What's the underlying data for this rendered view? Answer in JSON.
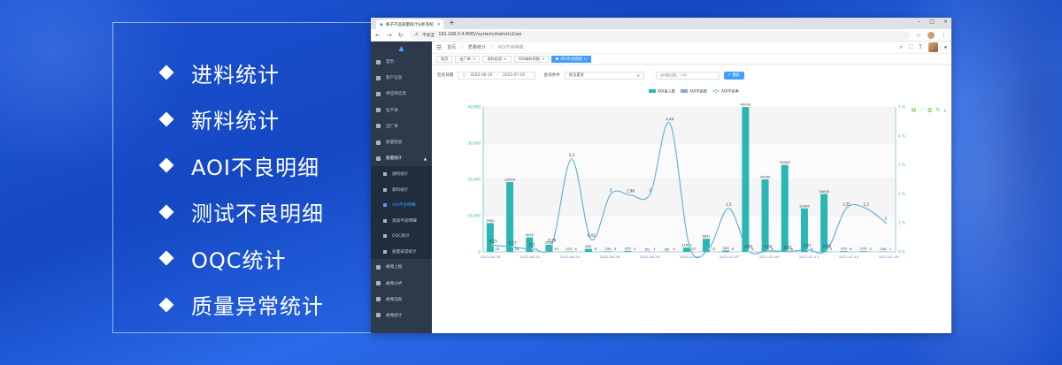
{
  "features": [
    "进料统计",
    "新料统计",
    "AOI不良明细",
    "测试不良明细",
    "OQC统计",
    "质量异常统计"
  ],
  "browser": {
    "tab_title": "格子产品质量统计分析系统",
    "new_tab": "+",
    "not_secure": "不安全",
    "url": "192.168.0.4:8082/system/statistic2/aoi",
    "win_min": "–",
    "win_max": "□",
    "win_close": "×"
  },
  "sidebar": {
    "items": [
      {
        "label": "首页"
      },
      {
        "label": "客户信息"
      },
      {
        "label": "供应商信息"
      },
      {
        "label": "生产单"
      },
      {
        "label": "出厂单"
      },
      {
        "label": "质量检验"
      },
      {
        "label": "质量统计",
        "open": true
      }
    ],
    "subitems": [
      {
        "label": "进料统计"
      },
      {
        "label": "新料统计"
      },
      {
        "label": "AOI不良明细",
        "active": true
      },
      {
        "label": "测试不良明细"
      },
      {
        "label": "OQC统计"
      },
      {
        "label": "质量异常统计"
      }
    ],
    "bottom_items": [
      {
        "label": "故障上报"
      },
      {
        "label": "故障分析"
      },
      {
        "label": "故障追踪"
      },
      {
        "label": "故障统计"
      }
    ]
  },
  "topnav": {
    "crumbs": [
      "首页",
      "质量统计",
      "AOI不良明细"
    ]
  },
  "tags": [
    {
      "label": "首页"
    },
    {
      "label": "出厂单"
    },
    {
      "label": "进料检验"
    },
    {
      "label": "AOI来料明细"
    },
    {
      "label": "AOI不良明细",
      "active": true
    }
  ],
  "filter": {
    "date_label": "检验日期",
    "date_start": "2022-06-16",
    "date_sep": "-",
    "date_end": "2022-07-16",
    "query_label": "查询条件",
    "query_placeholder": "按设置查",
    "multi_selected": "AOI投入数",
    "multi_more": "+3",
    "search_button": "搜索"
  },
  "colors": {
    "bar": "#2ab7b3",
    "line": "#5aaed0",
    "accent": "#409eff",
    "sidebar": "#2d3a4b"
  },
  "chart_data": {
    "type": "bar",
    "legend": [
      "AOI投入数",
      "AOI不良数",
      "AOI不良率"
    ],
    "x_tick_labels": [
      "2022-06-20",
      "2022-06-22",
      "2022-06-24",
      "2022-06-28",
      "2022-06-30",
      "2022-07-04",
      "2022-07-07",
      "2022-07-09",
      "2022-07-11",
      "2022-07-14",
      "2022-07-16"
    ],
    "y_left": {
      "ticks": [
        "0",
        "10,000",
        "20,000",
        "30,000",
        "40,000"
      ],
      "range": [
        0,
        40000
      ]
    },
    "y_right": {
      "ticks": [
        "0 %",
        "1 %",
        "2 %",
        "3 %",
        "4 %",
        "5 %"
      ],
      "range": [
        0,
        5
      ]
    },
    "series": [
      {
        "name": "AOI投入数",
        "values": [
          7950,
          19250,
          4010,
          2000,
          123,
          845,
          150,
          255,
          50,
          60,
          1160,
          3630,
          400,
          40000,
          20000,
          24000,
          12000,
          16000,
          210,
          200,
          100
        ]
      },
      {
        "name": "AOI不良数",
        "values": [
          23,
          18,
          1,
          14,
          4,
          6,
          3,
          5,
          1,
          4,
          27,
          11,
          6,
          8,
          8,
          6,
          9,
          5,
          8,
          5,
          1
        ]
      },
      {
        "name": "AOI不良率",
        "values": [
          0.23,
          0.17,
          0.1,
          0.26,
          3.2,
          0.43,
          2,
          1.96,
          2,
          4.44,
          0.2,
          0.12,
          1.5,
          0.04,
          0.04,
          0.02,
          0.07,
          0.06,
          1.51,
          1.5,
          1
        ]
      }
    ],
    "bar_labels": [
      "7950",
      "19250",
      "4010",
      "2000",
      "123",
      "845",
      "150",
      "255",
      "50",
      "60",
      "11822",
      "3631",
      "400",
      "40000",
      "20000",
      "24000",
      "12000",
      "16000",
      "210",
      "200",
      "100"
    ],
    "rate_labels": [
      "0.23",
      "0.17",
      "0.1",
      "0.26",
      "3.2",
      "0.43",
      "2",
      "1.96",
      "2",
      "4.44",
      "",
      "",
      "1.5",
      "0.04",
      "0.04",
      "0.02",
      "0.07",
      "0.06",
      "1.51",
      "1.5",
      "1"
    ],
    "defect_labels": [
      "23",
      "18",
      "1",
      "14",
      "4",
      "6",
      "3",
      "5",
      "1",
      "4",
      "27",
      "11",
      "6",
      "8",
      "8",
      "6",
      "9",
      "5",
      "8",
      "5",
      "1"
    ]
  }
}
